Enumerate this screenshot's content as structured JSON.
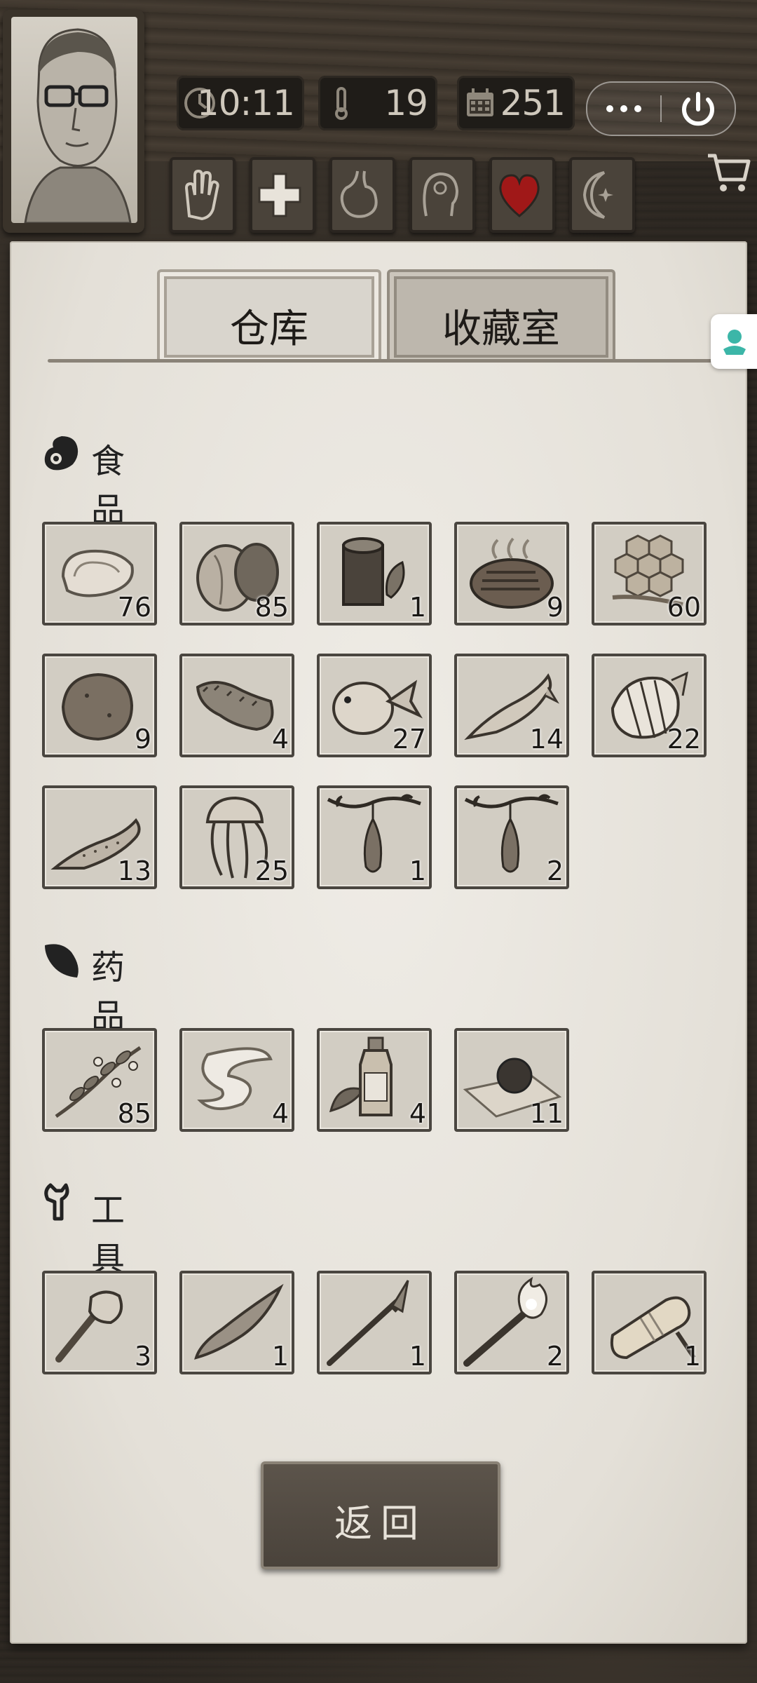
{
  "status_bar": {
    "time": "10:11",
    "temperature": "19",
    "day": "251"
  },
  "status_buttons": [
    "hand-icon",
    "medical-cross-icon",
    "stomach-icon",
    "brain-icon",
    "heart-icon",
    "moon-icon"
  ],
  "tabs": [
    {
      "label": "仓库",
      "active": true
    },
    {
      "label": "收藏室",
      "active": false
    }
  ],
  "sections": {
    "food": {
      "title": "食品",
      "items": [
        {
          "icon": "raw-meat-icon",
          "qty": "76"
        },
        {
          "icon": "coconut-icon",
          "qty": "85"
        },
        {
          "icon": "tea-canister-icon",
          "qty": "1"
        },
        {
          "icon": "grilled-steak-icon",
          "qty": "9"
        },
        {
          "icon": "honeycomb-icon",
          "qty": "60"
        },
        {
          "icon": "potato-icon",
          "qty": "9"
        },
        {
          "icon": "sea-cucumber-icon",
          "qty": "4"
        },
        {
          "icon": "pufferfish-icon",
          "qty": "27"
        },
        {
          "icon": "salmon-icon",
          "qty": "14"
        },
        {
          "icon": "butterflyfish-icon",
          "qty": "22"
        },
        {
          "icon": "trout-icon",
          "qty": "13"
        },
        {
          "icon": "jellyfish-icon",
          "qty": "25"
        },
        {
          "icon": "hanging-fruit-icon",
          "qty": "1"
        },
        {
          "icon": "hanging-fruit-icon",
          "qty": "2"
        }
      ]
    },
    "medicine": {
      "title": "药品",
      "items": [
        {
          "icon": "herb-icon",
          "qty": "85"
        },
        {
          "icon": "bandage-icon",
          "qty": "4"
        },
        {
          "icon": "medicine-bottle-icon",
          "qty": "4"
        },
        {
          "icon": "pill-on-leaf-icon",
          "qty": "11"
        }
      ]
    },
    "tools": {
      "title": "工具",
      "items": [
        {
          "icon": "stone-axe-icon",
          "qty": "3"
        },
        {
          "icon": "stone-knife-icon",
          "qty": "1"
        },
        {
          "icon": "spear-icon",
          "qty": "1"
        },
        {
          "icon": "torch-icon",
          "qty": "2"
        },
        {
          "icon": "flashlight-icon",
          "qty": "1"
        }
      ]
    }
  },
  "return_button": {
    "label": "返回"
  },
  "colors": {
    "heart": "#a01818",
    "panel": "#e7e3dc",
    "frame": "#4a4640"
  }
}
